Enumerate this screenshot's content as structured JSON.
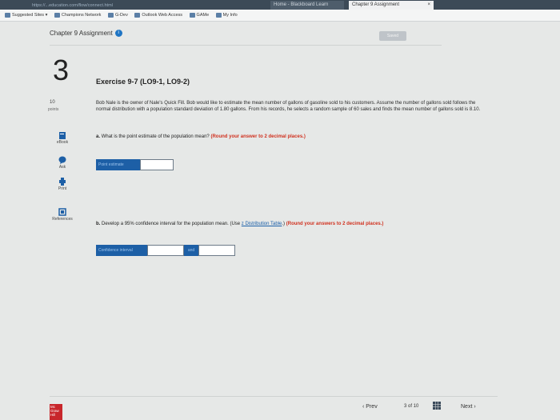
{
  "browser": {
    "url": "https://...education.com/flow/connect.html",
    "tabs": [
      {
        "label": "Home - Blackboard Learn"
      },
      {
        "label": "Chapter 9 Assignment",
        "close": "×"
      }
    ],
    "bookmarks": [
      "Suggested Sites ▾",
      "Champions Network",
      "G-Dev",
      "Outlook Web Access",
      "GAMe",
      "My Info"
    ]
  },
  "header": {
    "assignment_title": "Chapter 9 Assignment",
    "saved_label": "Saved"
  },
  "question": {
    "number": "3",
    "title": "Exercise 9-7 (LO9-1, LO9-2)",
    "points_value": "10",
    "points_label": "points",
    "problem_text": "Bob Nale is the owner of Nale's Quick Fill. Bob would like to estimate the mean number of gallons of gasoline sold to his customers. Assume the number of gallons sold follows the normal distribution with a population standard deviation of 1.80 gallons. From his records, he selects a random sample of 60 sales and finds the mean number of gallons sold is 8.10.",
    "part_a": {
      "letter": "a.",
      "text": "What is the point estimate of the population mean?",
      "hint": "(Round your answer to 2 decimal places.)",
      "answer_label": "Point estimate",
      "answer_value": ""
    },
    "part_b": {
      "letter": "b.",
      "text": "Develop a 95% confidence interval for the population mean. (Use ",
      "link": "z Distribution Table",
      "text_after": ".)",
      "hint": "(Round your answers to 2 decimal places.)",
      "answer_label": "Confidence interval",
      "lower_value": "",
      "and_label": "and",
      "upper_value": ""
    }
  },
  "sidebar_tools": [
    {
      "label": "eBook",
      "icon": "ebook-icon"
    },
    {
      "label": "Ask",
      "icon": "ask-icon"
    },
    {
      "label": "Print",
      "icon": "print-icon"
    },
    {
      "label": "References",
      "icon": "references-icon"
    }
  ],
  "footer": {
    "logo_text": "Mc Graw Hill",
    "prev_label": "Prev",
    "page_current": "3",
    "page_of": "of",
    "page_total": "10",
    "next_label": "Next"
  }
}
